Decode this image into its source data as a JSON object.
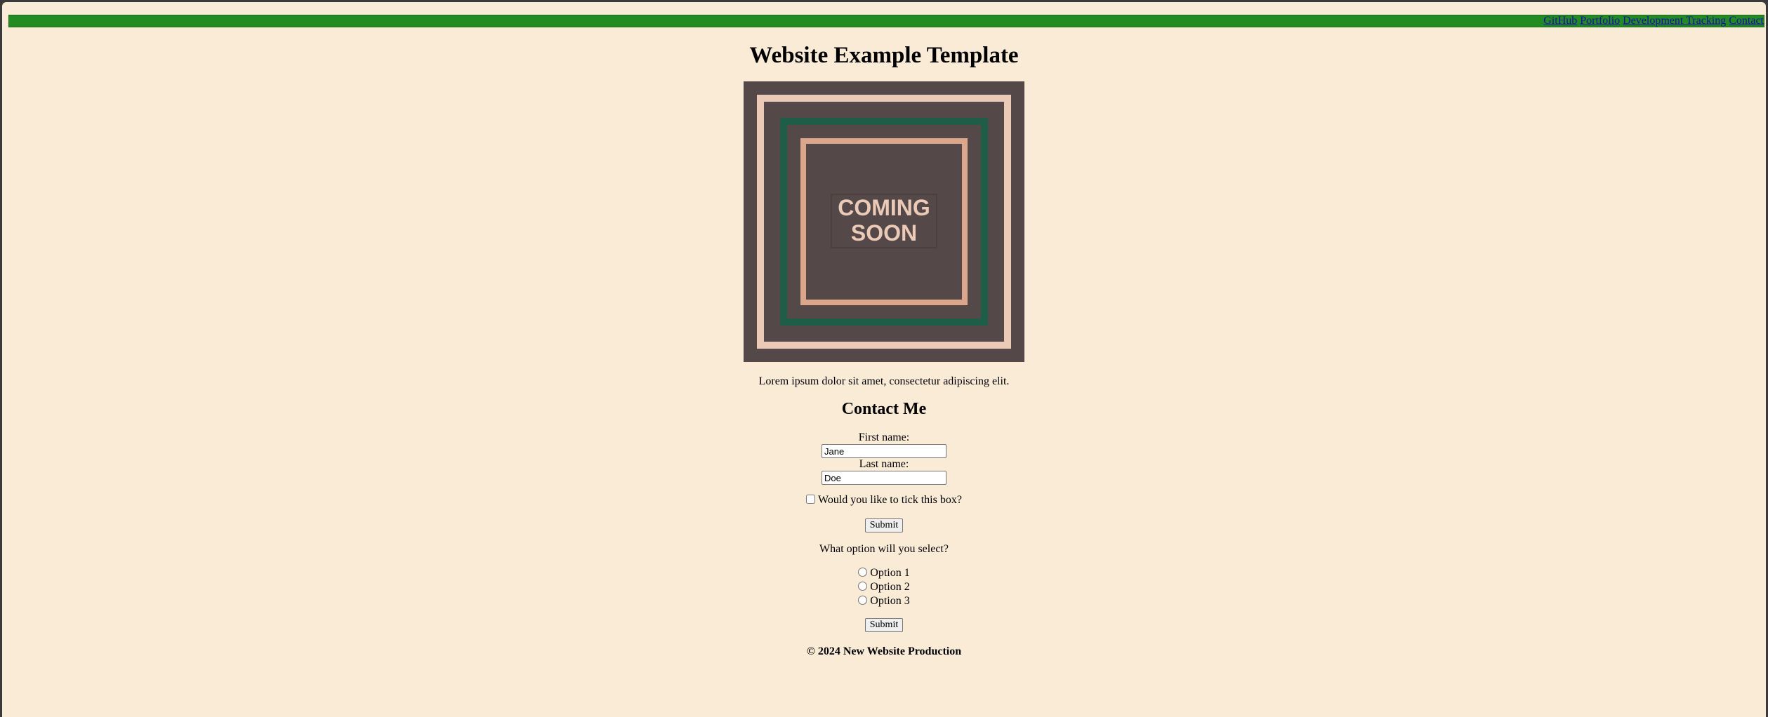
{
  "nav": {
    "links": [
      "GitHub",
      "Portfolio",
      "Development Tracking",
      "Contact"
    ]
  },
  "page": {
    "title": "Website Example Template",
    "hero_text_line1": "COMING",
    "hero_text_line2": "SOON",
    "intro": "Lorem ipsum dolor sit amet, consectetur adipiscing elit."
  },
  "contact": {
    "heading": "Contact Me",
    "first_name_label": "First name:",
    "first_name_value": "Jane",
    "last_name_label": "Last name:",
    "last_name_value": "Doe",
    "checkbox_label": "Would you like to tick this box?",
    "submit_label": "Submit",
    "question": "What option will you select?",
    "options": [
      "Option 1",
      "Option 2",
      "Option 3"
    ],
    "submit2_label": "Submit"
  },
  "footer": {
    "text": "© 2024 New Website Production"
  },
  "colors": {
    "background": "#faebd7",
    "nav": "#228b22",
    "hero_bg": "#544948",
    "hero_light": "#ebcab8",
    "hero_green": "#1e5e48",
    "hero_salmon": "#dca68c"
  }
}
